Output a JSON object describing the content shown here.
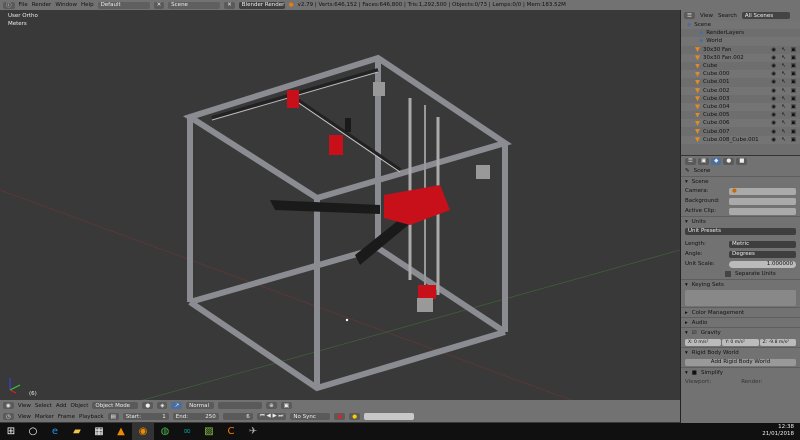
{
  "topbar": {
    "menus": [
      "File",
      "Render",
      "Window",
      "Help"
    ],
    "layout": "Default",
    "scene": "Scene",
    "engine": "Blender Render",
    "stats": "v2.79 | Verts:646,152 | Faces:646,800 | Tris:1,292,500 | Objects:0/73 | Lamps:0/0 | Mem:183.52M"
  },
  "viewport": {
    "view_name": "User Ortho",
    "units": "Meters",
    "frame_label": "(6)"
  },
  "outliner": {
    "menus": [
      "View",
      "Search"
    ],
    "filter": "All Scenes",
    "items": [
      {
        "name": "Scene",
        "icon": "scene-icon"
      },
      {
        "name": "RenderLayers",
        "icon": "renderlayers-icon"
      },
      {
        "name": "World",
        "icon": "world-icon"
      },
      {
        "name": "30x30 Fan",
        "icon": "mesh-icon"
      },
      {
        "name": "30x30 Fan.002",
        "icon": "mesh-icon"
      },
      {
        "name": "Cube",
        "icon": "mesh-icon"
      },
      {
        "name": "Cube.000",
        "icon": "mesh-icon"
      },
      {
        "name": "Cube.001",
        "icon": "mesh-icon"
      },
      {
        "name": "Cube.002",
        "icon": "mesh-icon"
      },
      {
        "name": "Cube.003",
        "icon": "mesh-icon"
      },
      {
        "name": "Cube.004",
        "icon": "mesh-icon"
      },
      {
        "name": "Cube.005",
        "icon": "mesh-icon"
      },
      {
        "name": "Cube.006",
        "icon": "mesh-icon"
      },
      {
        "name": "Cube.007",
        "icon": "mesh-icon"
      },
      {
        "name": "Cube.008_Cube.001",
        "icon": "mesh-icon"
      }
    ]
  },
  "properties": {
    "context": "Scene",
    "scene_panel": {
      "title": "Scene",
      "camera_label": "Camera:",
      "background_label": "Background:",
      "active_clip_label": "Active Clip:"
    },
    "units_panel": {
      "title": "Units",
      "presets": "Unit Presets",
      "length_label": "Length:",
      "length": "Metric",
      "angle_label": "Angle:",
      "angle": "Degrees",
      "scale_label": "Unit Scale:",
      "scale": "1.000000",
      "separate": "Separate Units"
    },
    "keying_sets": "Keying Sets",
    "color_management": "Color Management",
    "audio": "Audio",
    "gravity": {
      "title": "Gravity",
      "x": "X:    0 m/s²",
      "y": "Y:    0 m/s²",
      "z": "Z: -9.8 m/s²"
    },
    "rigid_body": {
      "title": "Rigid Body World",
      "button": "Add Rigid Body World"
    },
    "simplify": {
      "title": "Simplify",
      "viewport": "Viewport:",
      "render": "Render:"
    }
  },
  "header3d": {
    "menus": [
      "View",
      "Select",
      "Add",
      "Object"
    ],
    "mode": "Object Mode",
    "orientation": "Normal"
  },
  "timeline": {
    "menus": [
      "View",
      "Marker",
      "Frame",
      "Playback"
    ],
    "start": "Start:",
    "start_val": "1",
    "end": "End:",
    "end_val": "250",
    "current": "6",
    "sync": "No Sync"
  },
  "taskbar": {
    "time": "12:38",
    "date": "21/01/2018"
  },
  "colors": {
    "frame": "#8b8b92",
    "red": "#c8101a",
    "black": "#1a1a1a"
  }
}
